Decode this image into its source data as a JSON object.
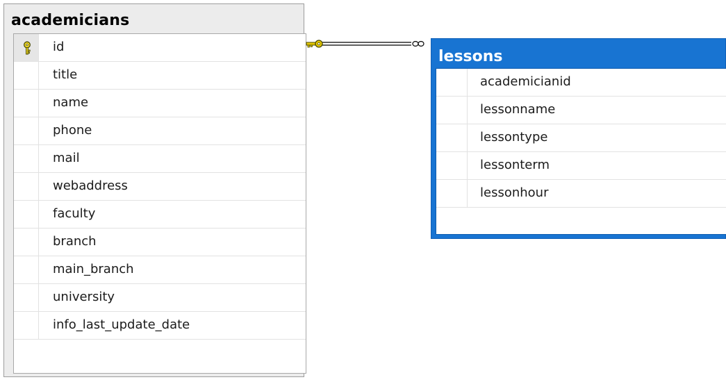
{
  "colors": {
    "selected_header": "#1874d2",
    "table_header": "#ececec",
    "key_icon": "#e5c800",
    "relation_line": "#000000"
  },
  "tables": [
    {
      "name": "academicians",
      "selected": false,
      "columns": [
        {
          "name": "id",
          "primary_key": true,
          "icon": "primary-key-icon"
        },
        {
          "name": "title"
        },
        {
          "name": "name"
        },
        {
          "name": "phone"
        },
        {
          "name": "mail"
        },
        {
          "name": "webaddress"
        },
        {
          "name": "faculty"
        },
        {
          "name": "branch"
        },
        {
          "name": "main_branch"
        },
        {
          "name": "university"
        },
        {
          "name": "info_last_update_date"
        }
      ]
    },
    {
      "name": "lessons",
      "selected": true,
      "columns": [
        {
          "name": "academicianid"
        },
        {
          "name": "lessonname"
        },
        {
          "name": "lessontype"
        },
        {
          "name": "lessonterm"
        },
        {
          "name": "lessonhour"
        }
      ]
    }
  ],
  "relationship": {
    "from_table": "academicians",
    "to_table": "lessons",
    "one_end_icon": "key-icon",
    "many_end_icon": "infinity-icon"
  }
}
